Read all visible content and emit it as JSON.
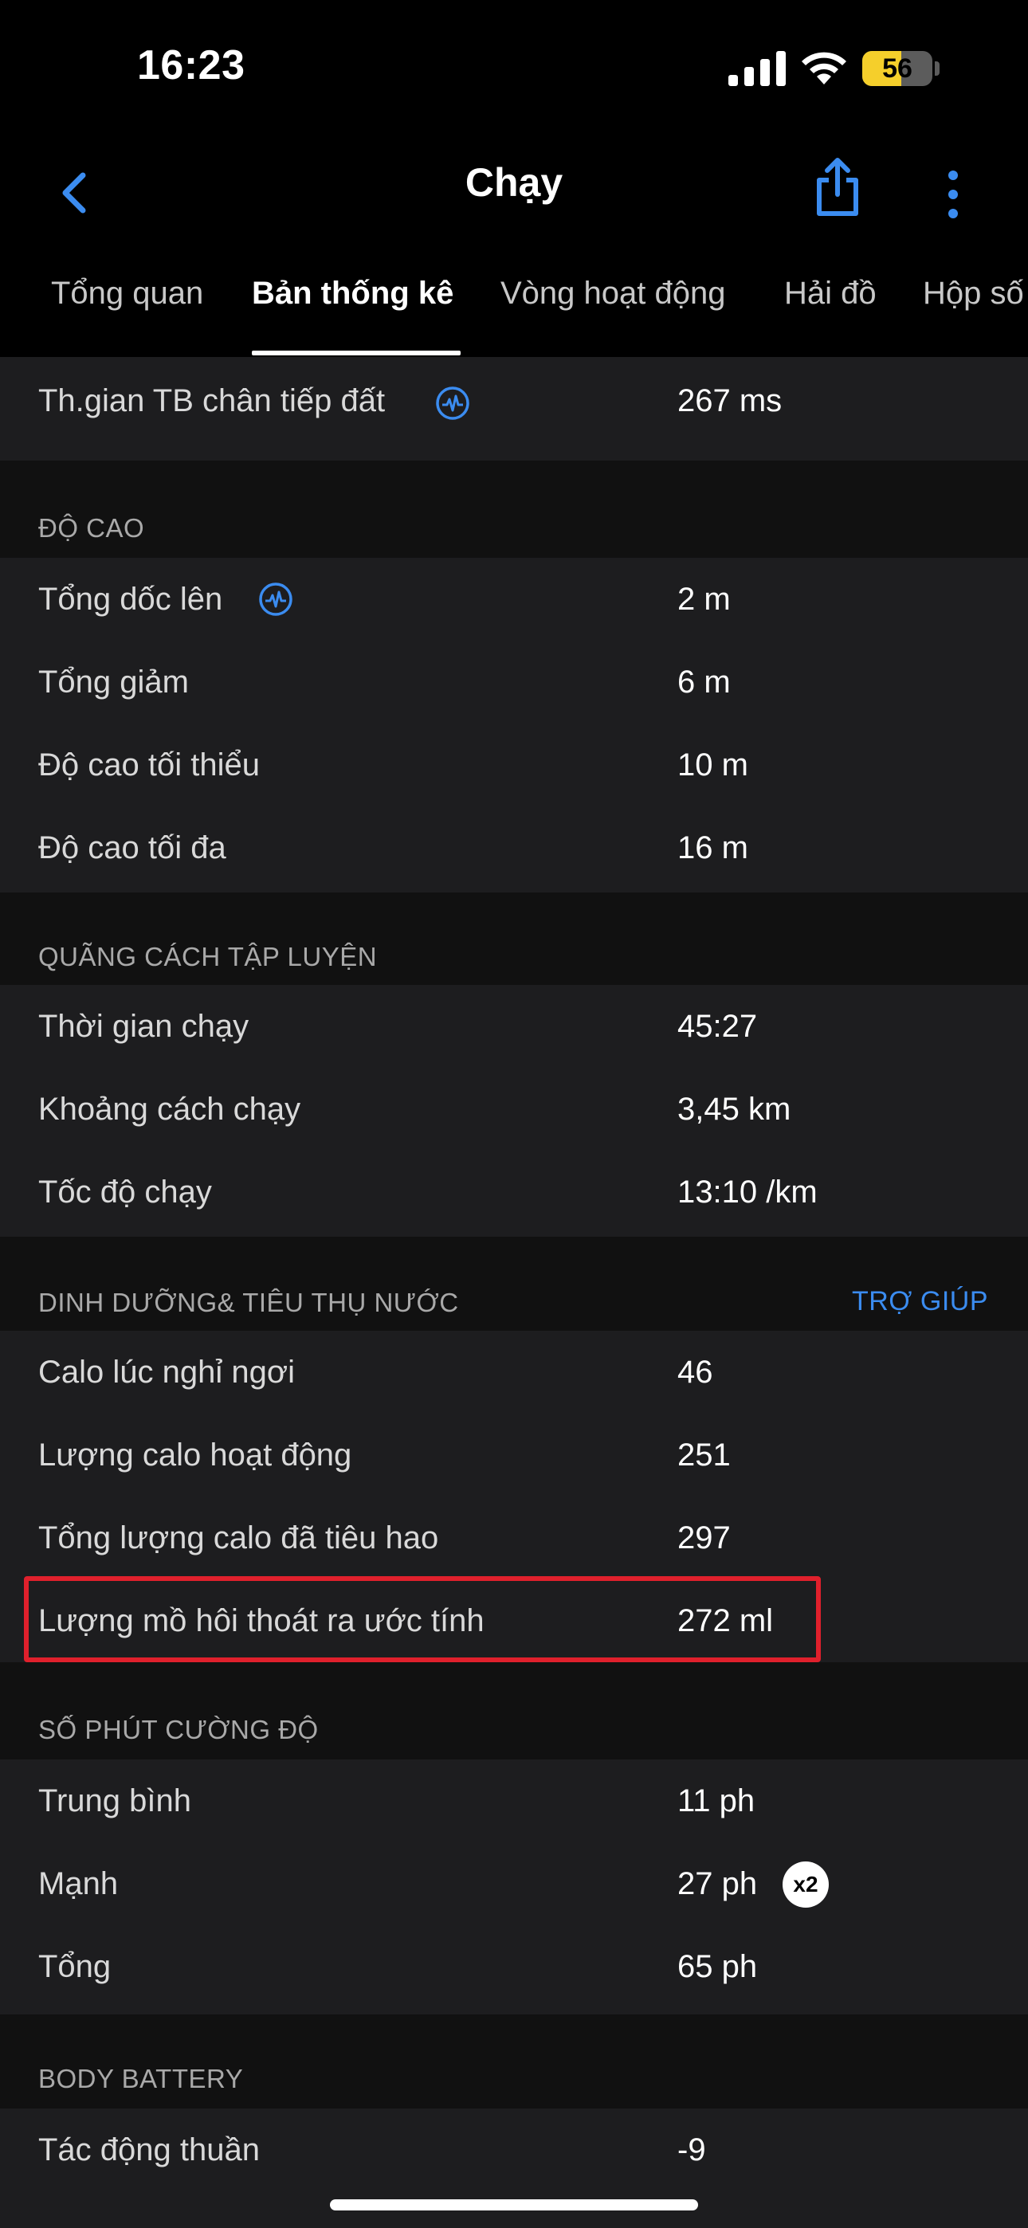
{
  "status": {
    "time": "16:23",
    "battery_level": "56",
    "battery_fraction": 0.56
  },
  "header": {
    "title": "Chạy",
    "back_icon": "chevron-left-icon",
    "share_icon": "share-icon",
    "more_icon": "more-vertical-icon"
  },
  "tabs": [
    {
      "label": "Tổng quan"
    },
    {
      "label": "Bản thống kê"
    },
    {
      "label": "Vòng hoạt động"
    },
    {
      "label": "Hải đồ"
    },
    {
      "label": "Hộp số"
    }
  ],
  "active_tab": 1,
  "top_row": {
    "label": "Th.gian TB chân tiếp đất",
    "value": "267 ms"
  },
  "sections": {
    "elevation": {
      "header": "ĐỘ CAO",
      "rows": [
        {
          "label": "Tổng dốc lên",
          "value": "2 m"
        },
        {
          "label": "Tổng giảm",
          "value": "6 m"
        },
        {
          "label": "Độ cao tối thiểu",
          "value": "10 m"
        },
        {
          "label": "Độ cao tối đa",
          "value": "16 m"
        }
      ]
    },
    "intervals": {
      "header": "QUÃNG CÁCH TẬP LUYỆN",
      "rows": [
        {
          "label": "Thời gian chạy",
          "value": "45:27"
        },
        {
          "label": "Khoảng cách chạy",
          "value": "3,45 km"
        },
        {
          "label": "Tốc độ chạy",
          "value": "13:10 /km"
        }
      ]
    },
    "nutrition": {
      "header": "DINH DƯỠNG& TIÊU THỤ NƯỚC",
      "help": "TRỢ GIÚP",
      "rows": [
        {
          "label": "Calo lúc nghỉ ngơi",
          "value": "46"
        },
        {
          "label": "Lượng calo hoạt động",
          "value": "251"
        },
        {
          "label": "Tổng lượng calo đã tiêu hao",
          "value": "297"
        },
        {
          "label": "Lượng mồ hôi thoát ra ước tính",
          "value": "272 ml"
        }
      ]
    },
    "intensity": {
      "header": "SỐ PHÚT CƯỜNG ĐỘ",
      "rows": [
        {
          "label": "Trung bình",
          "value": "11 ph"
        },
        {
          "label": "Mạnh",
          "value": "27 ph",
          "badge": "x2"
        },
        {
          "label": "Tổng",
          "value": "65 ph"
        }
      ]
    },
    "body_battery": {
      "header": "BODY BATTERY",
      "rows": [
        {
          "label": "Tác động thuần",
          "value": "-9"
        }
      ]
    }
  },
  "colors": {
    "accent": "#3b8cf0",
    "highlight": "#e0202c",
    "row_bg": "#1d1d1f",
    "section_bg": "#111111"
  }
}
